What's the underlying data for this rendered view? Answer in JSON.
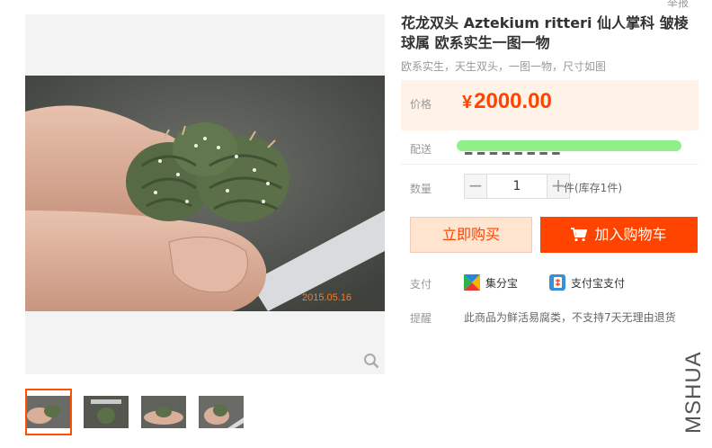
{
  "header": {
    "report_link": "举报"
  },
  "gallery": {
    "photo_date_stamp": "2015.05.16",
    "zoom_icon": "magnifier-icon",
    "thumbnails": [
      {
        "active": true
      },
      {
        "active": false
      },
      {
        "active": false
      },
      {
        "active": false
      }
    ]
  },
  "product": {
    "title": "花龙双头 Aztekium ritteri 仙人掌科 皱棱球属 欧系实生一图一物",
    "subtitle": "欧系实生，天生双头，一图一物，尺寸如图",
    "price_label": "价格",
    "currency": "¥",
    "price": "2000.00",
    "shipping_label": "配送",
    "shipping_text": "■ ■ ■ ■ ■ ■ ■ ■",
    "quantity_label": "数量",
    "quantity": "1",
    "minus": "−",
    "plus": "+",
    "stock_text": "件(库存1件)",
    "buy_now_label": "立即购买",
    "add_to_cart_label": "加入购物车",
    "payment_label": "支付",
    "payment_methods": [
      {
        "name": "集分宝",
        "icon": "jifenbao-icon"
      },
      {
        "name": "支付宝支付",
        "icon": "alipay-icon"
      }
    ],
    "notice_label": "提醒",
    "notice_text": "此商品为鲜活易腐类，不支持7天无理由退货"
  },
  "watermark": "MSHUA",
  "colors": {
    "accent": "#ff4400",
    "price_bg": "#fff2e8",
    "buy_now_bg": "#ffe4d0"
  }
}
